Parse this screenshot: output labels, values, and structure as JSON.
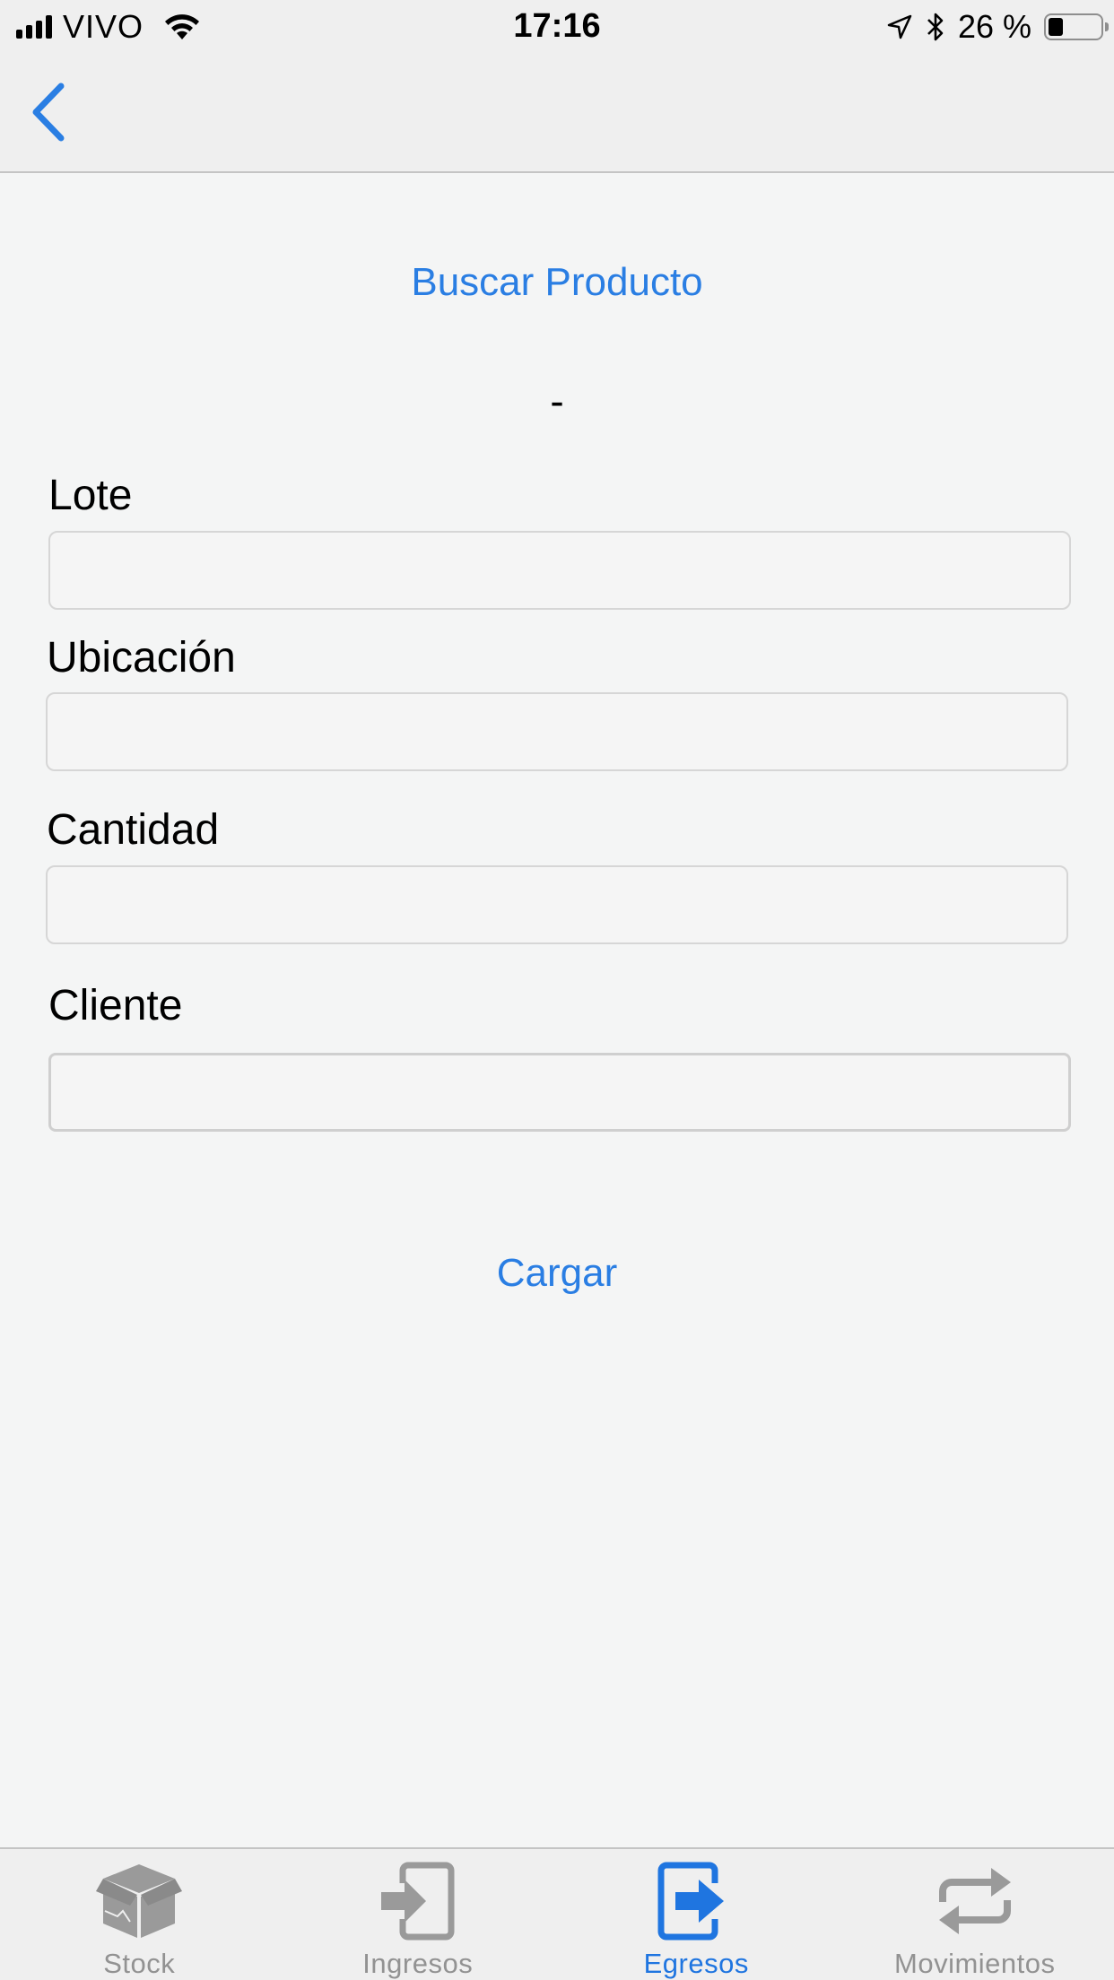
{
  "status_bar": {
    "carrier": "VIVO",
    "time": "17:16",
    "battery_percent": "26 %"
  },
  "nav": {
    "back_icon": "chevron-left-icon"
  },
  "form": {
    "search_button_label": "Buscar Producto",
    "product_name": "-",
    "fields": [
      {
        "label": "Lote",
        "value": ""
      },
      {
        "label": "Ubicación",
        "value": ""
      },
      {
        "label": "Cantidad",
        "value": ""
      },
      {
        "label": "Cliente",
        "value": ""
      }
    ],
    "submit_label": "Cargar"
  },
  "tabs": [
    {
      "label": "Stock",
      "icon": "box-icon",
      "active": false
    },
    {
      "label": "Ingresos",
      "icon": "sign-in-icon",
      "active": false
    },
    {
      "label": "Egresos",
      "icon": "sign-out-icon",
      "active": true
    },
    {
      "label": "Movimientos",
      "icon": "retweet-icon",
      "active": false
    }
  ],
  "colors": {
    "accent": "#2a7ee3",
    "inactive_tab": "#929292",
    "background": "#f4f5f5"
  }
}
